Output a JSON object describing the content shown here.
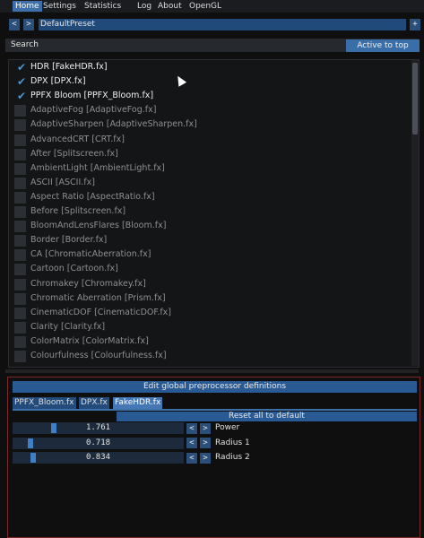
{
  "menu": {
    "tabs": [
      "Home",
      "Settings",
      "Statistics",
      "Log",
      "About",
      "OpenGL"
    ],
    "active": "Home"
  },
  "preset": {
    "prev": "<",
    "next": ">",
    "name": "DefaultPreset",
    "add": "+"
  },
  "search": {
    "label": "Search",
    "active_to_top": "Active to top"
  },
  "effects": [
    {
      "label": "HDR [FakeHDR.fx]",
      "enabled": true
    },
    {
      "label": "DPX [DPX.fx]",
      "enabled": true
    },
    {
      "label": "PPFX Bloom [PPFX_Bloom.fx]",
      "enabled": true
    },
    {
      "label": "AdaptiveFog [AdaptiveFog.fx]",
      "enabled": false
    },
    {
      "label": "AdaptiveSharpen [AdaptiveSharpen.fx]",
      "enabled": false
    },
    {
      "label": "AdvancedCRT [CRT.fx]",
      "enabled": false
    },
    {
      "label": "After [Splitscreen.fx]",
      "enabled": false
    },
    {
      "label": "AmbientLight [AmbientLight.fx]",
      "enabled": false
    },
    {
      "label": "ASCII [ASCII.fx]",
      "enabled": false
    },
    {
      "label": "Aspect Ratio [AspectRatio.fx]",
      "enabled": false
    },
    {
      "label": "Before [Splitscreen.fx]",
      "enabled": false
    },
    {
      "label": "BloomAndLensFlares [Bloom.fx]",
      "enabled": false
    },
    {
      "label": "Border [Border.fx]",
      "enabled": false
    },
    {
      "label": "CA [ChromaticAberration.fx]",
      "enabled": false
    },
    {
      "label": "Cartoon [Cartoon.fx]",
      "enabled": false
    },
    {
      "label": "Chromakey [Chromakey.fx]",
      "enabled": false
    },
    {
      "label": "Chromatic Aberration [Prism.fx]",
      "enabled": false
    },
    {
      "label": "CinematicDOF [CinematicDOF.fx]",
      "enabled": false
    },
    {
      "label": "Clarity [Clarity.fx]",
      "enabled": false
    },
    {
      "label": "ColorMatrix [ColorMatrix.fx]",
      "enabled": false
    },
    {
      "label": "Colourfulness [Colourfulness.fx]",
      "enabled": false
    }
  ],
  "editor": {
    "edit_defs": "Edit global preprocessor definitions",
    "tabs": [
      "PPFX_Bloom.fx",
      "DPX.fx",
      "FakeHDR.fx"
    ],
    "active_tab": "FakeHDR.fx",
    "reset": "Reset all to default",
    "params": [
      {
        "name": "Power",
        "value": "1.761",
        "level": 0.23
      },
      {
        "name": "Radius 1",
        "value": "0.718",
        "level": 0.09
      },
      {
        "name": "Radius 2",
        "value": "0.834",
        "level": 0.11
      }
    ],
    "dec": "<",
    "inc": ">"
  },
  "colors": {
    "accent": "#3d6fa8",
    "check": "#4f93d6",
    "panel_border": "#7a2a2a"
  }
}
